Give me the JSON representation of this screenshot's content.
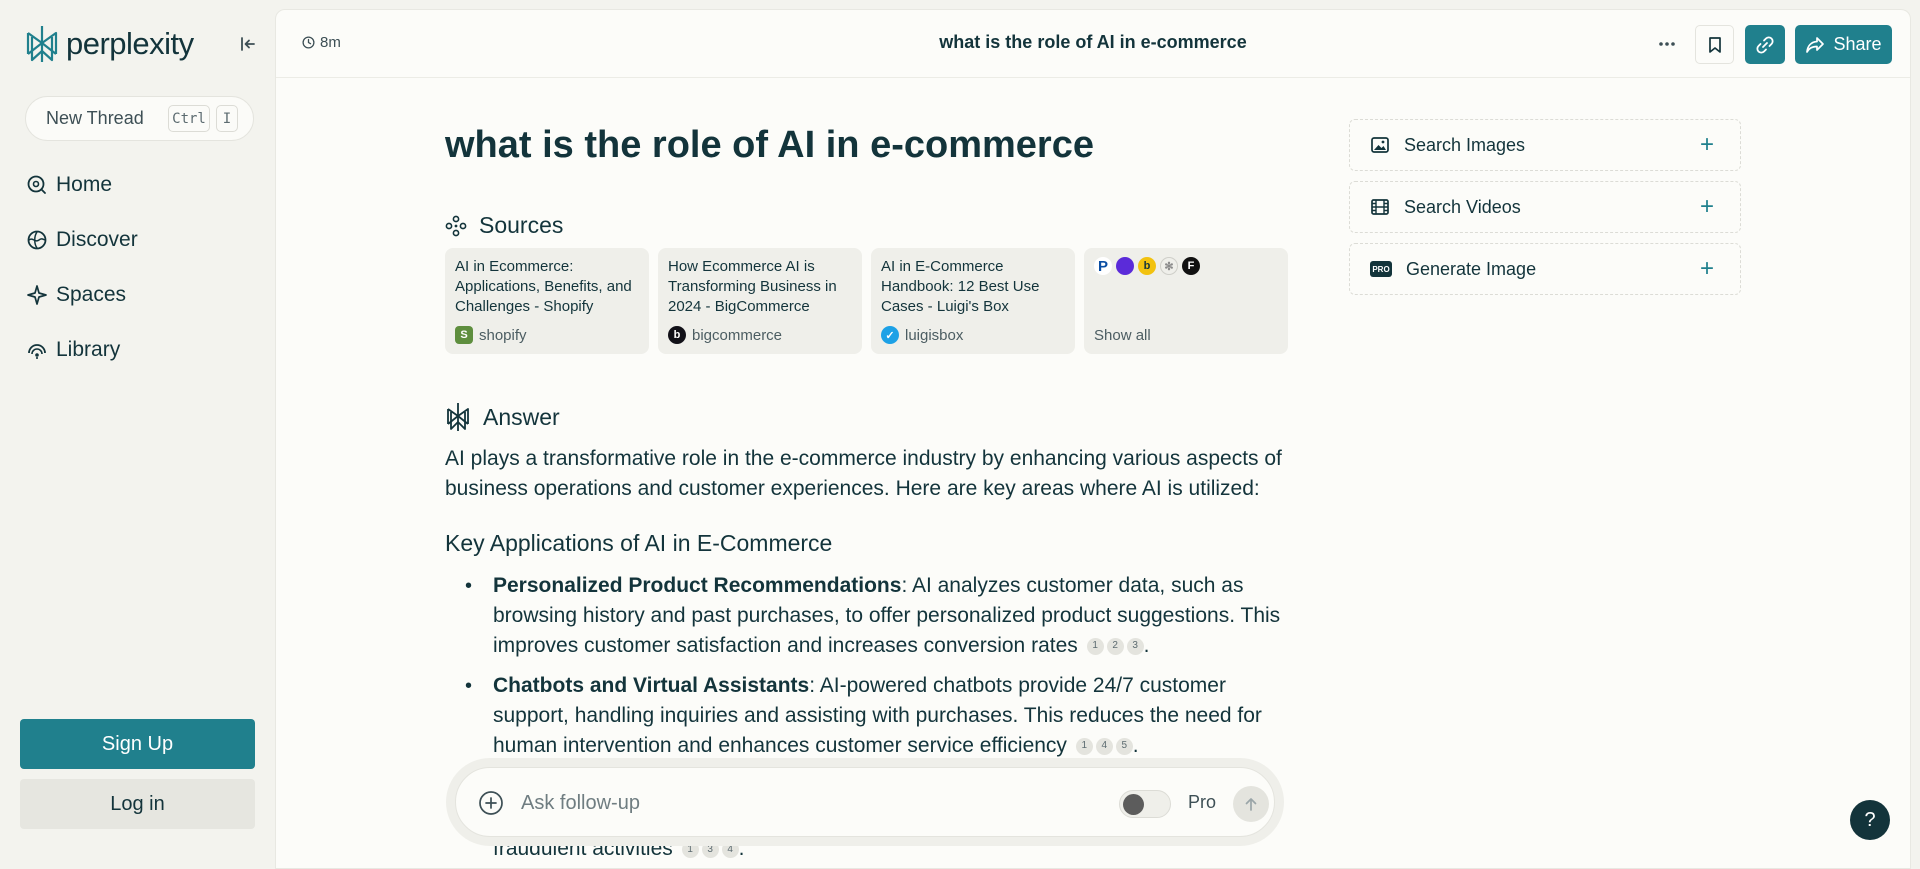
{
  "sidebar": {
    "logo_text": "perplexity",
    "new_thread": {
      "label": "New Thread",
      "kbd_ctrl": "Ctrl",
      "kbd_key": "I"
    },
    "nav": [
      {
        "label": "Home",
        "icon": "search-circle-icon"
      },
      {
        "label": "Discover",
        "icon": "globe-icon"
      },
      {
        "label": "Spaces",
        "icon": "spaces-icon"
      },
      {
        "label": "Library",
        "icon": "library-icon"
      }
    ],
    "signup_label": "Sign Up",
    "login_label": "Log in"
  },
  "topbar": {
    "timer": "8m",
    "title": "what is the role of AI in e-commerce",
    "share_label": "Share"
  },
  "main": {
    "query_title": "what is the role of AI in e-commerce",
    "sources_label": "Sources",
    "sources": [
      {
        "title": "AI in Ecommerce: Applications, Benefits, and Challenges - Shopify",
        "domain": "shopify"
      },
      {
        "title": "How Ecommerce AI is Transforming Business in 2024 - BigCommerce",
        "domain": "bigcommerce"
      },
      {
        "title": "AI in E-Commerce Handbook: 12 Best Use Cases - Luigi's Box",
        "domain": "luigisbox"
      }
    ],
    "show_all_label": "Show all",
    "answer_label": "Answer",
    "answer_intro": "AI plays a transformative role in the e-commerce industry by enhancing various aspects of business operations and customer experiences. Here are key areas where AI is utilized:",
    "key_heading": "Key Applications of AI in E-Commerce",
    "bullets": [
      {
        "bold": "Personalized Product Recommendations",
        "text": ": AI analyzes customer data, such as browsing history and past purchases, to offer personalized product suggestions. This improves customer satisfaction and increases conversion rates",
        "cites": [
          "1",
          "2",
          "3"
        ]
      },
      {
        "bold": "Chatbots and Virtual Assistants",
        "text": ": AI-powered chatbots provide 24/7 customer support, handling inquiries and assisting with purchases. This reduces the need for human intervention and enhances customer service efficiency",
        "cites": [
          "1",
          "4",
          "5"
        ]
      }
    ],
    "tail_text": "fraudulent activities",
    "tail_cites": [
      "1",
      "3",
      "4"
    ]
  },
  "side_actions": [
    {
      "label": "Search Images",
      "icon": "image-icon"
    },
    {
      "label": "Search Videos",
      "icon": "film-icon"
    },
    {
      "label": "Generate Image",
      "icon": "pro-badge-icon",
      "badge": "PRO"
    }
  ],
  "followup": {
    "placeholder": "Ask follow-up",
    "pro_label": "Pro"
  },
  "help_label": "?",
  "colors": {
    "accent": "#20808d",
    "text": "#13343b",
    "bg": "#f3f3ee"
  }
}
